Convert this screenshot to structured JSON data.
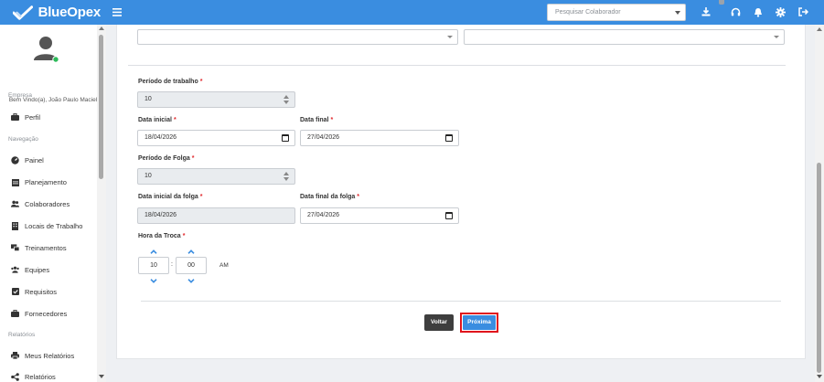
{
  "header": {
    "brand": "BlueOpex",
    "search_placeholder": "Pesquisar Colaborador",
    "icons": [
      "menu-icon",
      "download-icon",
      "headset-icon",
      "bell-icon",
      "gear-icon",
      "logout-icon"
    ],
    "bg_color": "#3a8de0"
  },
  "sidebar": {
    "welcome": "Bem Vindo(a), João Paulo Maciel",
    "sections": {
      "empresa": "Empresa",
      "navegacao": "Navegação",
      "relatorios": "Relatórios"
    },
    "items": [
      {
        "label": "Perfil",
        "icon": "briefcase-icon"
      },
      {
        "label": "Painel",
        "icon": "dashboard-icon"
      },
      {
        "label": "Planejamento",
        "icon": "calendar-icon"
      },
      {
        "label": "Colaboradores",
        "icon": "users-icon"
      },
      {
        "label": "Locais de Trabalho",
        "icon": "building-icon"
      },
      {
        "label": "Treinamentos",
        "icon": "training-icon"
      },
      {
        "label": "Equipes",
        "icon": "team-icon"
      },
      {
        "label": "Requisitos",
        "icon": "checkbox-icon"
      },
      {
        "label": "Fornecedores",
        "icon": "briefcase-icon"
      },
      {
        "label": "Meus Relatórios",
        "icon": "print-icon"
      },
      {
        "label": "Relatórios",
        "icon": "share-icon"
      }
    ]
  },
  "form": {
    "periodo_trabalho": {
      "label": "Período de trabalho",
      "value": "10"
    },
    "data_inicial": {
      "label": "Data inicial",
      "value": "18/04/2026"
    },
    "data_final": {
      "label": "Data final",
      "value": "27/04/2026"
    },
    "periodo_folga": {
      "label": "Período de Folga",
      "value": "10"
    },
    "data_inicial_folga": {
      "label": "Data inicial da folga",
      "value": "18/04/2026"
    },
    "data_final_folga": {
      "label": "Data final da folga",
      "value": "27/04/2026"
    },
    "hora_troca": {
      "label": "Hora da Troca",
      "hour": "10",
      "minute": "00",
      "separator": ":",
      "period": "AM"
    },
    "required_mark": "*"
  },
  "actions": {
    "back": "Voltar",
    "next": "Próxima"
  }
}
